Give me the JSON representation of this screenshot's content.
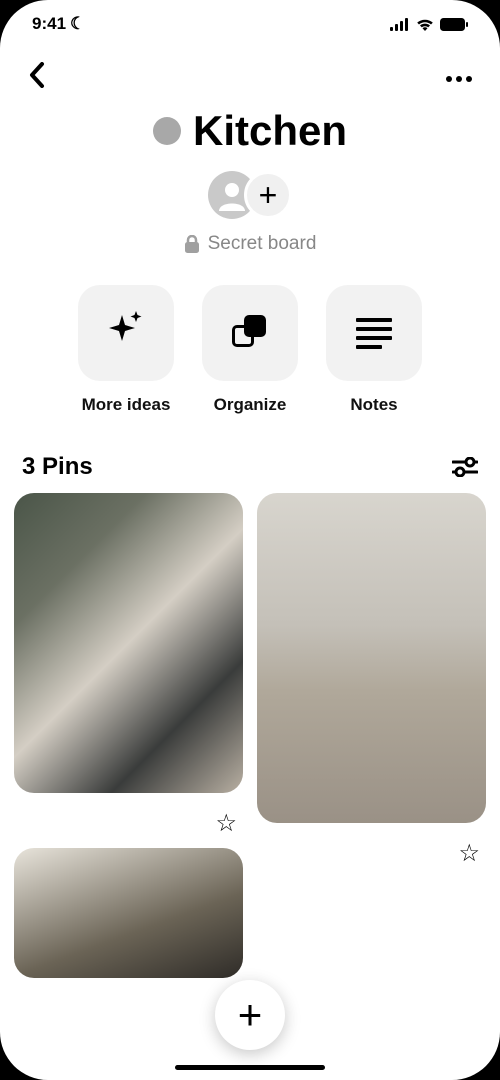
{
  "status": {
    "time": "9:41",
    "moon": "☾"
  },
  "board": {
    "title": "Kitchen",
    "secret_label": "Secret board"
  },
  "actions": {
    "more_ideas": {
      "label": "More ideas"
    },
    "organize": {
      "label": "Organize"
    },
    "notes": {
      "label": "Notes"
    }
  },
  "pins_header": {
    "count_label": "3 Pins"
  },
  "icons": {
    "plus": "+",
    "star": "☆"
  }
}
